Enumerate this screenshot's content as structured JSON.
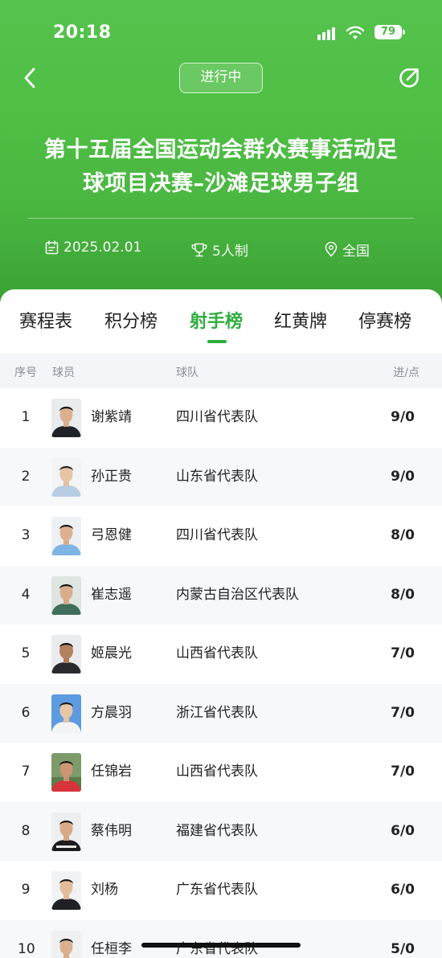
{
  "status_bar": {
    "time": "20:18",
    "battery": "79"
  },
  "header": {
    "status_pill": "进行中",
    "title_line1": "第十五届全国运动会群众赛事活动足",
    "title_line2": "球项目决赛–沙滩足球男子组",
    "date": "2025.02.01",
    "format": "5人制",
    "region": "全国"
  },
  "tabs": [
    {
      "label": "赛程表",
      "active": false
    },
    {
      "label": "积分榜",
      "active": false
    },
    {
      "label": "射手榜",
      "active": true
    },
    {
      "label": "红黄牌",
      "active": false
    },
    {
      "label": "停赛榜",
      "active": false
    }
  ],
  "table": {
    "columns": {
      "rank": "序号",
      "player": "球员",
      "team": "球队",
      "score": "进/点"
    },
    "rows": [
      {
        "rank": "1",
        "name": "谢紫靖",
        "team": "四川省代表队",
        "score": "9/0"
      },
      {
        "rank": "2",
        "name": "孙正贵",
        "team": "山东省代表队",
        "score": "9/0"
      },
      {
        "rank": "3",
        "name": "弓恩健",
        "team": "四川省代表队",
        "score": "8/0"
      },
      {
        "rank": "4",
        "name": "崔志遥",
        "team": "内蒙古自治区代表队",
        "score": "8/0"
      },
      {
        "rank": "5",
        "name": "姬晨光",
        "team": "山西省代表队",
        "score": "7/0"
      },
      {
        "rank": "6",
        "name": "方晨羽",
        "team": "浙江省代表队",
        "score": "7/0"
      },
      {
        "rank": "7",
        "name": "任锦岩",
        "team": "山西省代表队",
        "score": "7/0"
      },
      {
        "rank": "8",
        "name": "蔡伟明",
        "team": "福建省代表队",
        "score": "6/0"
      },
      {
        "rank": "9",
        "name": "刘杨",
        "team": "广东省代表队",
        "score": "6/0"
      },
      {
        "rank": "10",
        "name": "任桓李",
        "team": "广东省代表队",
        "score": "5/0"
      }
    ]
  },
  "icons": {
    "back": "chevron-left-icon",
    "share": "share-icon",
    "date": "calendar-icon",
    "format": "trophy-icon",
    "region": "location-pin-icon"
  },
  "colors": {
    "accent": "#2fae3e",
    "hero": "#4fbf45"
  }
}
